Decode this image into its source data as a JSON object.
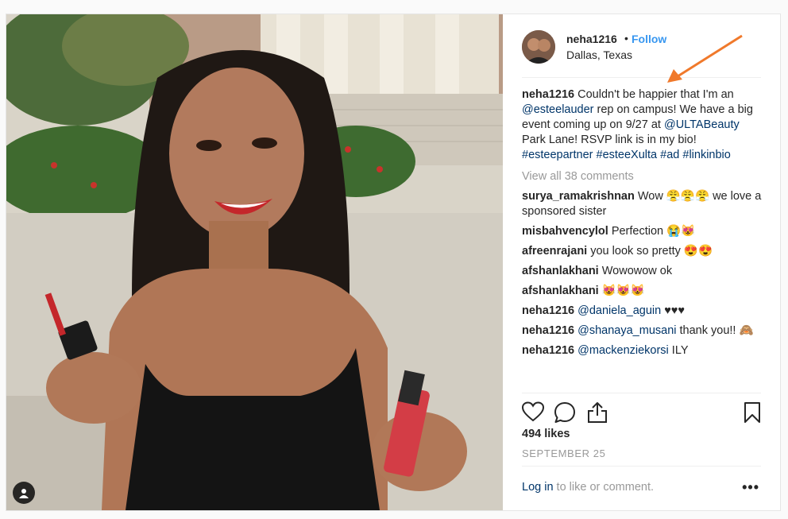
{
  "post": {
    "username": "neha1216",
    "dot": "•",
    "follow_label": "Follow",
    "location": "Dallas, Texas",
    "caption": {
      "user": "neha1216",
      "t1": " Couldn't be happier that I'm an ",
      "m1": "@esteelauder",
      "t2": " rep on campus! We have a big event coming up on 9/27 at ",
      "m2": "@ULTABeauty",
      "t3": " Park Lane! RSVP link is in my bio! ",
      "h1": "#esteepartner",
      "h2": "#esteeXulta",
      "h3": "#ad",
      "h4": "#linkinbio"
    },
    "view_all": "View all 38 comments",
    "comments": [
      {
        "user": "surya_ramakrishnan",
        "text": " Wow 😤😤😤 we love a sponsored sister"
      },
      {
        "user": "misbahvencylol",
        "text": " Perfection 😭😻"
      },
      {
        "user": "afreenrajani",
        "text": " you look so pretty 😍😍"
      },
      {
        "user": "afshanlakhani",
        "text": " Wowowow ok"
      },
      {
        "user": "afshanlakhani",
        "text": " 😻😻😻"
      },
      {
        "user": "neha1216",
        "mention": "@daniela_aguin",
        "text": " ♥♥♥"
      },
      {
        "user": "neha1216",
        "mention": "@shanaya_musani",
        "text": " thank you!! 🙈"
      },
      {
        "user": "neha1216",
        "mention": "@mackenziekorsi",
        "text": " ILY"
      }
    ],
    "likes": "494 likes",
    "date": "SEPTEMBER 25",
    "login_link": "Log in",
    "login_rest": " to like or comment.",
    "more": "•••"
  },
  "icons": {
    "like": "heart-icon",
    "comment": "comment-icon",
    "share": "share-icon",
    "save": "bookmark-icon",
    "tag": "user-tag-icon"
  },
  "colors": {
    "follow": "#3897f0",
    "link": "#003569",
    "muted": "#999999",
    "arrow": "#f0792b"
  }
}
